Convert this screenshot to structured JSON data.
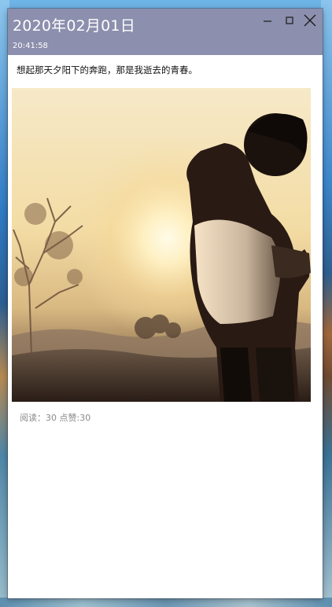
{
  "wallpaper": {
    "accent": "#3a86c8"
  },
  "window": {
    "title_date": "2020年02月01日",
    "title_time": "20:41:58",
    "titlebar_color": "#8c8fad",
    "controls": {
      "minimize_icon": "minimize-icon",
      "maximize_icon": "maximize-icon",
      "close_icon": "close-icon"
    }
  },
  "post": {
    "text": "想起那天夕阳下的奔跑，那是我逝去的青春。",
    "image_subject": "silhouette-at-sunset",
    "stats": {
      "read_label": "阅读：",
      "read_count": "30",
      "like_label": "点赞:",
      "like_count": "30"
    }
  }
}
